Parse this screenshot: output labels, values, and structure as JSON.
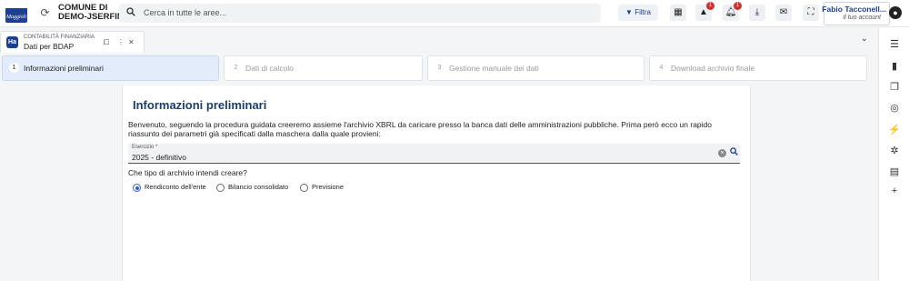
{
  "header": {
    "logo_text": "Maggioli",
    "org_line1": "COMUNE DI",
    "org_line2": "DEMO-JSERFIN",
    "search_placeholder": "Cerca in tutte le aree...",
    "filter_label": "Filtra",
    "alerts_badge": "1",
    "notifications_badge": "1",
    "user_name": "Fabio Tacconell...",
    "user_sub": "Il tuo account"
  },
  "tab": {
    "badge": "Ha",
    "section": "CONTABILITÀ FINANZIARIA",
    "title": "Dati per BDAP"
  },
  "steps": [
    {
      "num": "1",
      "label": "Informazioni preliminari"
    },
    {
      "num": "2",
      "label": "Dati di calcolo"
    },
    {
      "num": "3",
      "label": "Gestione manuale dei dati"
    },
    {
      "num": "4",
      "label": "Download archivio finale"
    }
  ],
  "main": {
    "title": "Informazioni preliminari",
    "intro": "Benvenuto, seguendo la procedura guidata creeremo assieme l'archivio XBRL da caricare presso la banca dati delle amministrazioni pubbliche. Prima però ecco un rapido riassunto dei parametri già specificati dalla maschera dalla quale provieni:",
    "field_label": "Esercizio",
    "field_required": "*",
    "field_value": "2025 - definitivo",
    "question": "Che tipo di archivio intendi creare?",
    "options": [
      "Rendiconto dell'ente",
      "Bilancio consolidato",
      "Previsione"
    ],
    "selected_option": 0
  },
  "colors": {
    "brand": "#1d3f8f",
    "active_step": "#e3ecfa",
    "badge": "#d32f2f"
  }
}
